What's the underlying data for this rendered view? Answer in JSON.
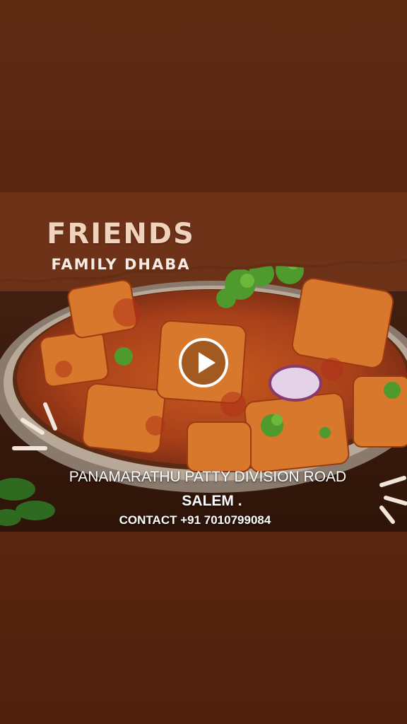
{
  "video": {
    "title": "FRIENDS",
    "subtitle": "FAMILY  DHABA",
    "address_line1": "PANAMARATHU PATTY DIVISION ROAD",
    "address_line2": "SALEM .",
    "contact": "CONTACT +91 7010799084",
    "play_icon": "play-icon"
  },
  "colors": {
    "background": "#5a2510",
    "title": "#f1d2bd",
    "text": "#ffffff"
  }
}
